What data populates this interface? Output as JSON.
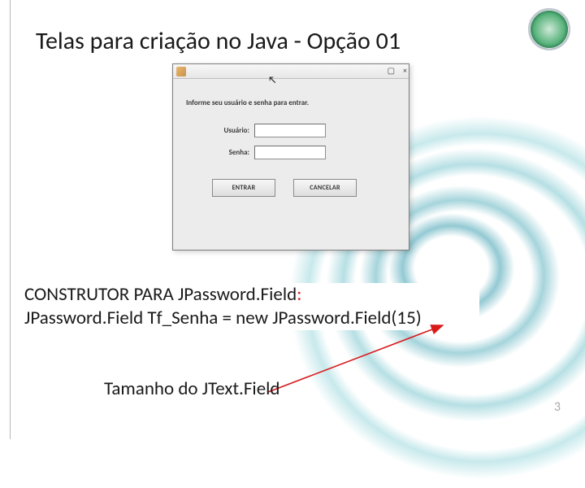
{
  "title": "Telas para criação no Java - Opção 01",
  "window": {
    "titlebar": {
      "minimize": "▢",
      "close": "×"
    },
    "message": "Informe seu usuário e senha para entrar.",
    "labels": {
      "user": "Usuário:",
      "password": "Senha:"
    },
    "buttons": {
      "enter": "ENTRAR",
      "cancel": "CANCELAR"
    }
  },
  "codebox": {
    "line1_prefix": "CONSTRUTOR PARA JPassword.Field",
    "line1_colon": ":",
    "line2": "JPassword.Field Tf_Senha = new JPassword.Field(15)"
  },
  "caption": "Tamanho do JText.Field",
  "page_number": "3"
}
